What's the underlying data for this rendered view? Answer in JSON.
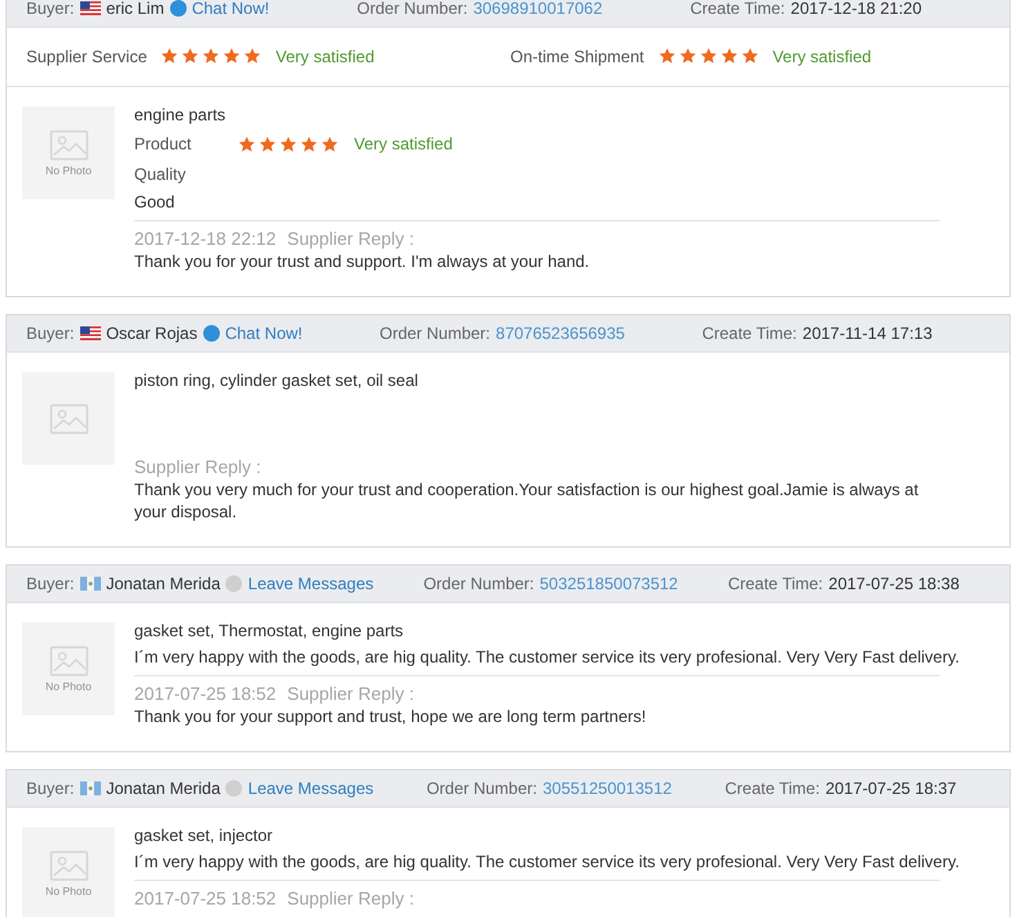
{
  "reviews": [
    {
      "buyer": {
        "label": "Buyer:",
        "flag": {
          "kind": "stripes"
        },
        "name": "eric Lim",
        "online": true,
        "contact": "Chat Now!"
      },
      "order": {
        "label": "Order Number:",
        "number": "30698910017062"
      },
      "created": {
        "label": "Create Time:",
        "time": "2017-12-18 21:20"
      },
      "store_ratings": [
        {
          "label": "Supplier Service",
          "stars": 5,
          "verdict": "Very satisfied"
        },
        {
          "label": "On-time Shipment",
          "stars": 5,
          "verdict": "Very satisfied"
        }
      ],
      "item": {
        "photo_caption": "No Photo",
        "title": "engine parts",
        "rating": {
          "label": "Product Quality",
          "stars": 5,
          "verdict": "Very satisfied"
        },
        "comment": "Good"
      },
      "reply": {
        "time": "2017-12-18 22:12",
        "label": "Supplier Reply :",
        "text": "Thank you for your trust and support. I'm always at your hand."
      }
    },
    {
      "buyer": {
        "label": "Buyer:",
        "flag": {
          "kind": "stripes"
        },
        "name": "Oscar Rojas",
        "online": true,
        "contact": "Chat Now!"
      },
      "order": {
        "label": "Order Number:",
        "number": "87076523656935"
      },
      "created": {
        "label": "Create Time:",
        "time": "2017-11-14 17:13"
      },
      "item": {
        "title": "piston ring, cylinder gasket set, oil seal"
      },
      "reply": {
        "label": "Supplier Reply :",
        "text": "Thank you very much for your trust and cooperation.Your satisfaction is our highest goal.Jamie is always at your disposal."
      }
    },
    {
      "buyer": {
        "label": "Buyer:",
        "flag": {
          "kind": "triband"
        },
        "name": "Jonatan Merida",
        "online": false,
        "contact": "Leave Messages"
      },
      "order": {
        "label": "Order Number:",
        "number": "503251850073512"
      },
      "created": {
        "label": "Create Time:",
        "time": "2017-07-25 18:38"
      },
      "item": {
        "photo_caption": "No Photo",
        "title": "gasket set, Thermostat, engine parts",
        "comment": "I´m very happy with the goods, are hig quality. The customer service its very profesional. Very Very Fast delivery."
      },
      "reply": {
        "time": "2017-07-25 18:52",
        "label": "Supplier Reply :",
        "text": "Thank you for your support and trust, hope we are long term partners!"
      }
    },
    {
      "buyer": {
        "label": "Buyer:",
        "flag": {
          "kind": "triband"
        },
        "name": "Jonatan Merida",
        "online": false,
        "contact": "Leave Messages"
      },
      "order": {
        "label": "Order Number:",
        "number": "30551250013512"
      },
      "created": {
        "label": "Create Time:",
        "time": "2017-07-25 18:37"
      },
      "item": {
        "photo_caption": "No Photo",
        "title": "gasket set, injector",
        "comment": "I´m very happy with the goods, are hig quality. The customer service its very profesional. Very Very Fast delivery."
      },
      "reply": {
        "time": "2017-07-25 18:52",
        "label": "Supplier Reply :"
      }
    }
  ]
}
